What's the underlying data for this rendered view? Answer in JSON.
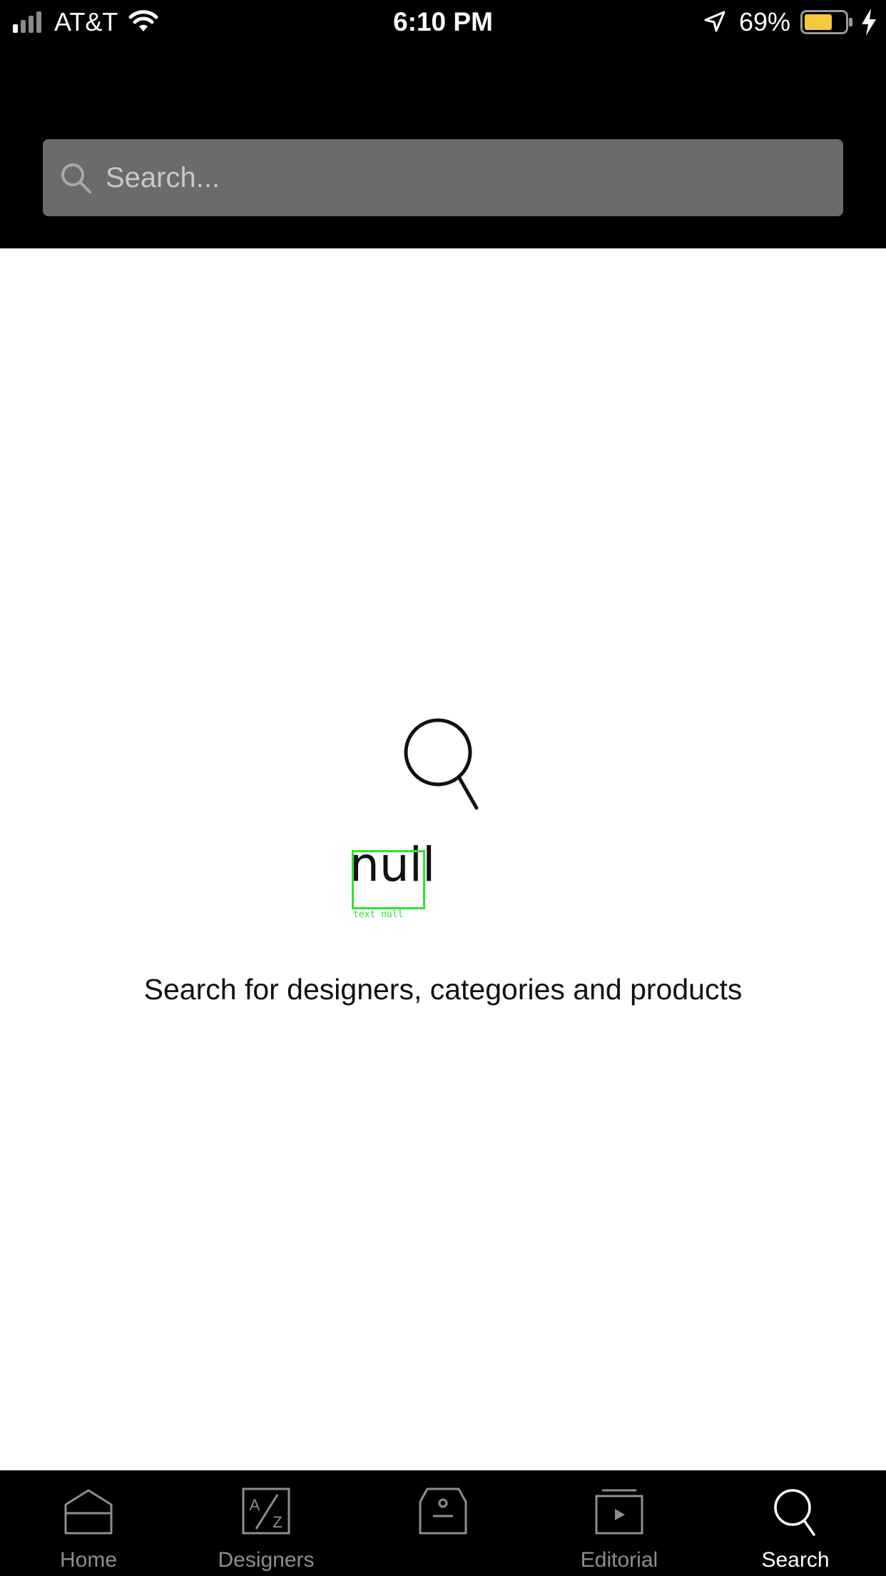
{
  "status_bar": {
    "carrier": "AT&T",
    "time": "6:10 PM",
    "battery_percent": "69%",
    "battery_level": 0.69,
    "battery_color": "#f5c842",
    "icons": [
      "cellular-signal-icon",
      "wifi-icon",
      "location-arrow-icon",
      "battery-icon",
      "charging-bolt-icon"
    ]
  },
  "search": {
    "placeholder": "Search...",
    "value": "",
    "background_color": "#6b6b6b"
  },
  "empty_state": {
    "icon": "magnifier-icon",
    "placeholder_text": "null",
    "debug_label": "text null",
    "debug_color": "#2ee52e",
    "message": "Search for designers, categories and products"
  },
  "tabbar": {
    "active": "Search",
    "tabs": [
      {
        "label": "Home",
        "icon": "home-icon"
      },
      {
        "label": "Designers",
        "icon": "designers-az-icon"
      },
      {
        "label": "",
        "icon": "shopping-bag-icon"
      },
      {
        "label": "Editorial",
        "icon": "editorial-play-icon"
      },
      {
        "label": "Search",
        "icon": "search-icon"
      }
    ]
  }
}
